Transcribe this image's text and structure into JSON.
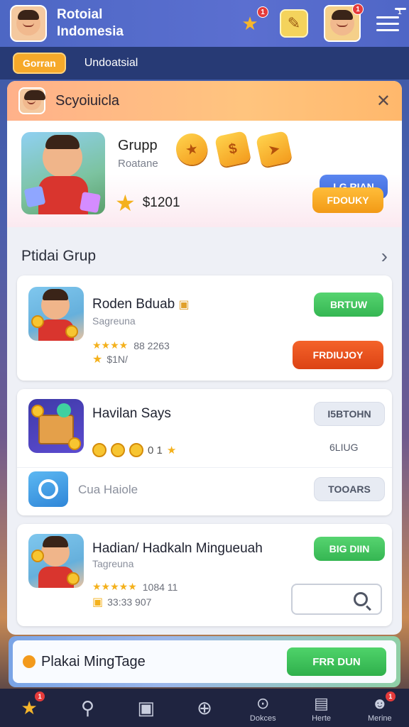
{
  "header": {
    "app_title_line1": "Rotoial",
    "app_title_line2": "Indomesia",
    "star_badge": "1",
    "char_badge": "1",
    "menu_badge": "1"
  },
  "subnav": {
    "active_tab": "Gorran",
    "tab2": "Undoatsial"
  },
  "hero": {
    "title": "Scyoiuicla",
    "group_label": "Grupp",
    "group_sub": "Roatane",
    "primary_button": "LG RIAN",
    "amount": "$1201",
    "secondary_button": "FDOUKY"
  },
  "section": {
    "title": "Ptidai Grup"
  },
  "cards": [
    {
      "title": "Roden Bduab",
      "subtitle": "Sagreuna",
      "rating_text": "88 2263",
      "meta_text": "$1N/",
      "button_top": "BRTUW",
      "button_bottom": "FRDIUJOY"
    },
    {
      "title": "Havilan Says",
      "coins_text": "0 1",
      "button_top": "I5BTOHN",
      "right_value": "6LIUG",
      "row2_label": "Cua Haiole",
      "row2_button": "TOOARS"
    },
    {
      "title": "Hadian/ Hadkaln Mingueuah",
      "subtitle": "Tagreuna",
      "rating_text": "1084 11",
      "meta_text": "33:33 907",
      "button_top": "BIG DIIN"
    }
  ],
  "promo": {
    "text": "Plakai MingTage",
    "button": "FRR DUN"
  },
  "nav": {
    "home_badge": "1",
    "item5_label": "Dokces",
    "item6_label": "Herte",
    "item7_label": "Merine",
    "item7_badge": "1"
  },
  "colors": {
    "header": "#4d67c4",
    "accent_orange": "#f6a92a",
    "accent_green": "#35b652",
    "accent_red": "#dc4214",
    "accent_blue": "#3f6adc",
    "nav_bg": "#1f2440"
  },
  "icons": [
    "star-icon",
    "pencil-icon",
    "menu-icon",
    "close-icon",
    "chevron-right-icon",
    "search-icon",
    "home-icon",
    "box-icon",
    "plus-icon",
    "download-icon",
    "news-icon",
    "profile-icon"
  ]
}
